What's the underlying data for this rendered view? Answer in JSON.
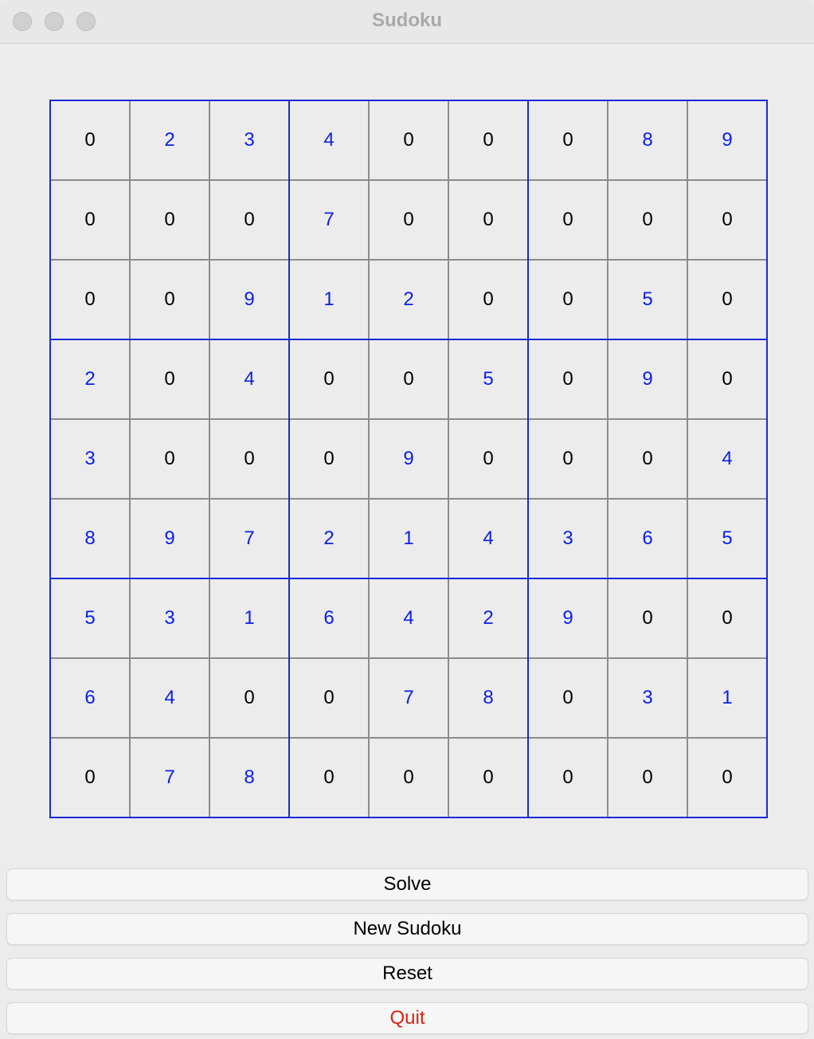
{
  "window": {
    "title": "Sudoku"
  },
  "colors": {
    "given": "#0a1ee6",
    "empty": "#000000",
    "box_border": "#1a2ad6",
    "cell_border": "#8c8c8c",
    "quit": "#e02010"
  },
  "board": [
    [
      0,
      2,
      3,
      4,
      0,
      0,
      0,
      8,
      9
    ],
    [
      0,
      0,
      0,
      7,
      0,
      0,
      0,
      0,
      0
    ],
    [
      0,
      0,
      9,
      1,
      2,
      0,
      0,
      5,
      0
    ],
    [
      2,
      0,
      4,
      0,
      0,
      5,
      0,
      9,
      0
    ],
    [
      3,
      0,
      0,
      0,
      9,
      0,
      0,
      0,
      4
    ],
    [
      8,
      9,
      7,
      2,
      1,
      4,
      3,
      6,
      5
    ],
    [
      5,
      3,
      1,
      6,
      4,
      2,
      9,
      0,
      0
    ],
    [
      6,
      4,
      0,
      0,
      7,
      8,
      0,
      3,
      1
    ],
    [
      0,
      7,
      8,
      0,
      0,
      0,
      0,
      0,
      0
    ]
  ],
  "buttons": {
    "solve": "Solve",
    "new_sudoku": "New Sudoku",
    "reset": "Reset",
    "quit": "Quit"
  }
}
